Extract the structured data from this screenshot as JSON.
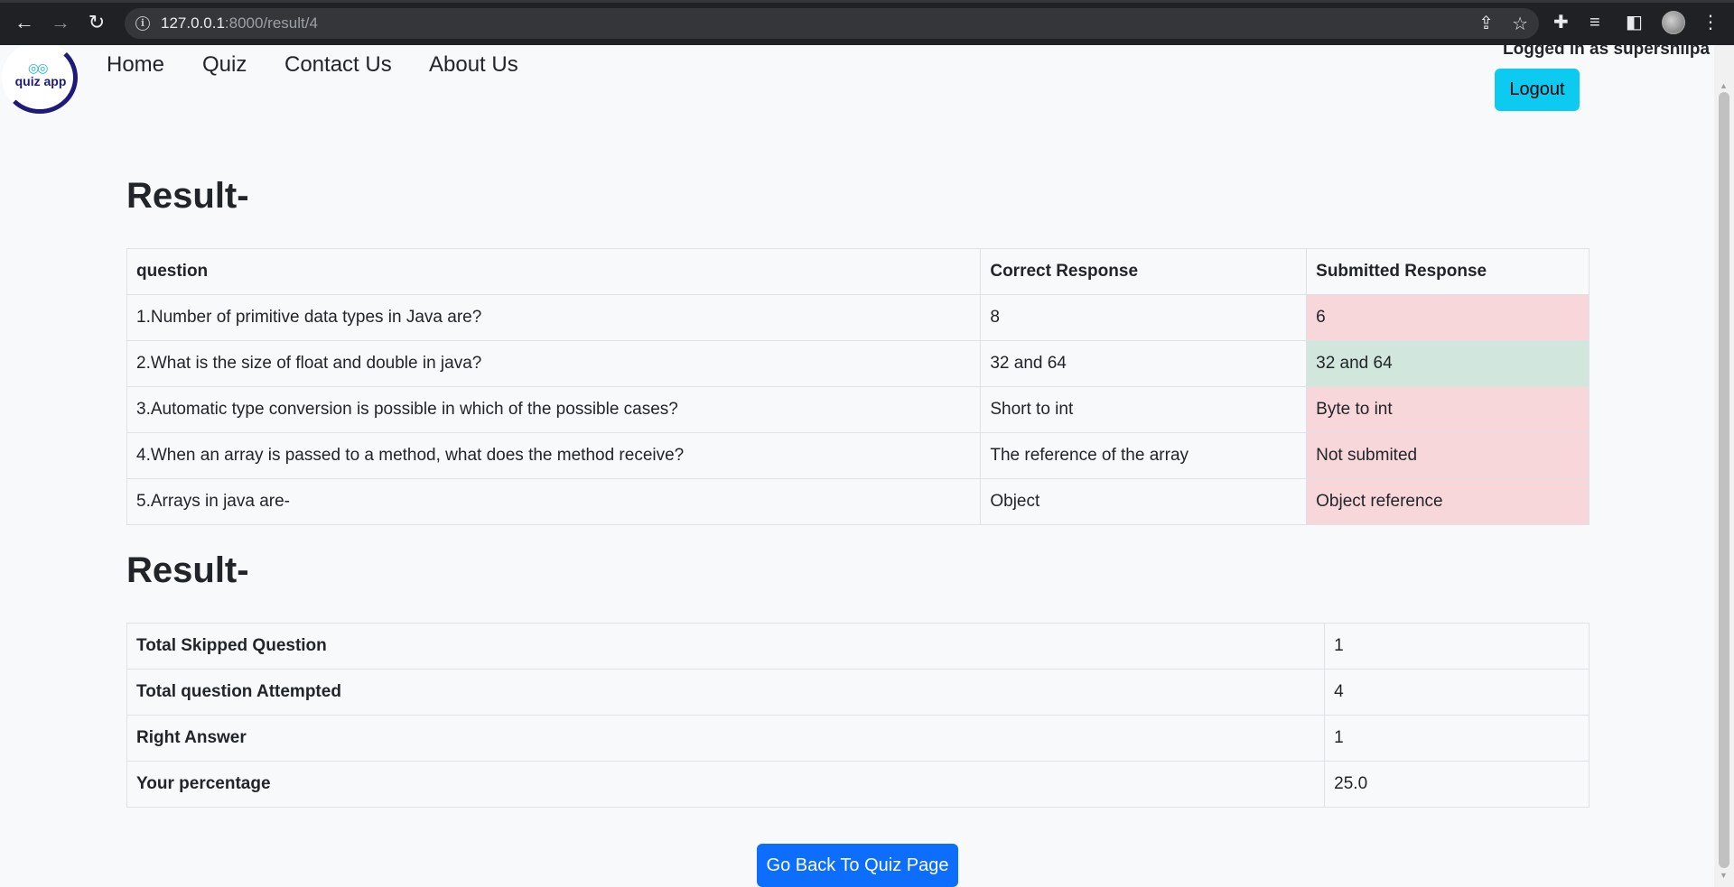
{
  "browser": {
    "url_host": "127.0.0.1",
    "url_path": ":8000/result/4"
  },
  "navbar": {
    "logo_text": "quiz app",
    "links": [
      "Home",
      "Quiz",
      "Contact Us",
      "About Us"
    ],
    "logged_in_text": "Logged in as supershilpa",
    "logout_label": "Logout"
  },
  "results": {
    "heading": "Result-",
    "columns": [
      "question",
      "Correct Response",
      "Submitted Response"
    ],
    "rows": [
      {
        "question": "1.Number of primitive data types in Java are?",
        "correct": "8",
        "submitted": "6",
        "status": "wrong"
      },
      {
        "question": "2.What is the size of float and double in java?",
        "correct": "32 and 64",
        "submitted": "32 and 64",
        "status": "right"
      },
      {
        "question": "3.Automatic type conversion is possible in which of the possible cases?",
        "correct": "Short to int",
        "submitted": "Byte to int",
        "status": "wrong"
      },
      {
        "question": "4.When an array is passed to a method, what does the method receive?",
        "correct": "The reference of the array",
        "submitted": "Not submited",
        "status": "wrong"
      },
      {
        "question": "5.Arrays in java are-",
        "correct": "Object",
        "submitted": "Object reference",
        "status": "wrong"
      }
    ]
  },
  "summary": {
    "heading": "Result-",
    "rows": [
      {
        "label": "Total Skipped Question",
        "value": "1"
      },
      {
        "label": "Total question Attempted",
        "value": "4"
      },
      {
        "label": "Right Answer",
        "value": "1"
      },
      {
        "label": "Your percentage",
        "value": "25.0"
      }
    ]
  },
  "back_button_label": "Go Back To Quiz Page",
  "colors": {
    "wrong_bg": "#f8d7da",
    "right_bg": "#d1e7dd",
    "logout_bg": "#0dcaf0",
    "primary": "#0d6efd"
  }
}
